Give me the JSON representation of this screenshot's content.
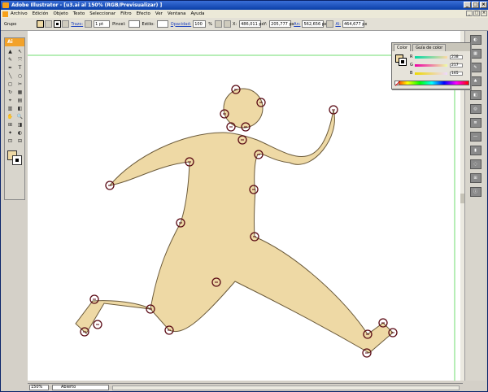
{
  "window": {
    "title": "Adobe Illustrator - [u3.ai al 150% (RGB/Previsualizar) ]",
    "controls": [
      "_",
      "□",
      "×"
    ]
  },
  "menu": {
    "items": [
      "Archivo",
      "Edición",
      "Objeto",
      "Texto",
      "Seleccionar",
      "Filtro",
      "Efecto",
      "Ver",
      "Ventana",
      "Ayuda"
    ]
  },
  "control_bar": {
    "selection": "Grupo",
    "stroke_label": "Trazo:",
    "stroke_weight": "1 pt",
    "brush_label": "Pincel:",
    "style_label": "Estilo:",
    "opacity_label": "Opacidad:",
    "opacity_value": "100",
    "opacity_unit": "%",
    "x_label": "X:",
    "x_value": "486,011 px",
    "y_label": "Y:",
    "y_value": "205,777 px",
    "w_label": "An:",
    "w_value": "562,656 px",
    "h_label": "Al:",
    "h_value": "464,677 px"
  },
  "toolbar": {
    "header": "Ai",
    "tools": [
      "▲",
      "↖",
      "✎",
      "⤧",
      "✒",
      "T",
      "╲",
      "○",
      "◻",
      "✂",
      "↻",
      "▦",
      "⌖",
      "▤",
      "▥",
      "◧",
      "✋",
      "🔍",
      "⊞",
      "◨",
      "✦",
      "◐",
      "⊡",
      "⊟"
    ]
  },
  "color_panel": {
    "tabs": [
      "Color",
      "Guía de color"
    ],
    "r_label": "R",
    "r_value": "238",
    "g_label": "G",
    "g_value": "217",
    "b_label": "B",
    "b_value": "165"
  },
  "colors": {
    "fill": "#eed9a5",
    "stroke": "#000000",
    "anchor": "#5a0a14",
    "guide": "#6fdc6f"
  },
  "status_bar": {
    "zoom": "150%",
    "state": "Abierto"
  }
}
